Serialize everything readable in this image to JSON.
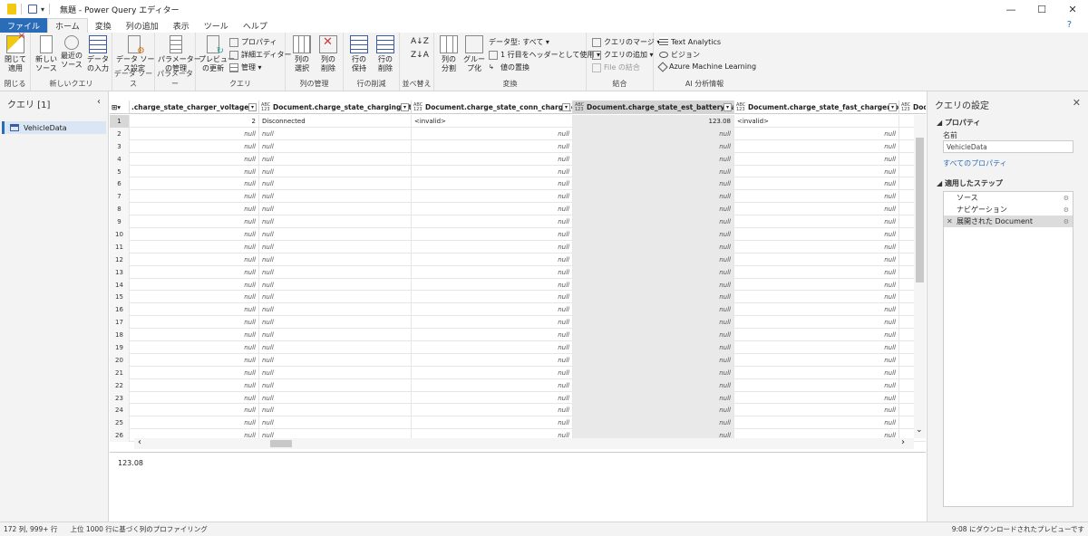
{
  "window": {
    "title": "無題 - Power Query エディター"
  },
  "tabs": [
    "ファイル",
    "ホーム",
    "変換",
    "列の追加",
    "表示",
    "ツール",
    "ヘルプ"
  ],
  "ribbon": {
    "close_apply": "閉じて\n適用",
    "new_source": "新しい\nソース",
    "recent_source": "最近の\nソース",
    "data_input": "データ\nの入力",
    "data_source_settings": "データ ソー\nス設定",
    "manage_params": "パラメーター\nの管理",
    "refresh_preview": "プレビュー\nの更新",
    "properties": "プロパティ",
    "advanced_editor": "詳細エディター",
    "manage": "管理",
    "choose_cols": "列の\n選択",
    "remove_cols": "列の\n削除",
    "keep_rows": "行の\n保持",
    "remove_rows": "行の\n削除",
    "split_col": "列の\n分割",
    "group_by": "グルー\nプ化",
    "data_type": "データ型: すべて",
    "first_row_header": "1 行目をヘッダーとして使用",
    "replace_values": "値の置換",
    "merge_queries": "クエリのマージ",
    "append_queries": "クエリの追加",
    "combine_files": "File の結合",
    "text_analytics": "Text Analytics",
    "vision": "ビジョン",
    "azure_ml": "Azure Machine Learning",
    "groups": [
      "閉じる",
      "新しいクエリ",
      "データ ソース",
      "パラメーター",
      "クエリ",
      "列の管理",
      "行の削減",
      "並べ替え",
      "変換",
      "結合",
      "AI 分析情報"
    ]
  },
  "queries": {
    "header": "クエリ [1]",
    "items": [
      "VehicleData"
    ]
  },
  "grid": {
    "columns": [
      {
        "name": ".charge_state_charger_voltage",
        "type": ""
      },
      {
        "name": "Document.charge_state_charging_state",
        "type": "ABC\n123"
      },
      {
        "name": "Document.charge_state_conn_charge_cable",
        "type": "ABC\n123"
      },
      {
        "name": "Document.charge_state_est_battery_range",
        "type": "ABC\n123"
      },
      {
        "name": "Document.charge_state_fast_charger_brand",
        "type": "ABC\n123"
      },
      {
        "name": "Document",
        "type": "ABC\n123"
      }
    ],
    "first_row": [
      "2",
      "Disconnected",
      "<invalid>",
      "123.08",
      "<invalid>",
      ""
    ],
    "null_text": "null",
    "row_count_shown": 26
  },
  "preview_value": "123.08",
  "settings": {
    "title": "クエリの設定",
    "properties": "プロパティ",
    "name_label": "名前",
    "name_value": "VehicleData",
    "all_props": "すべてのプロパティ",
    "applied_steps": "適用したステップ",
    "steps": [
      "ソース",
      "ナビゲーション",
      "展開された Document"
    ]
  },
  "status": {
    "left": "172 列, 999+ 行",
    "middle": "上位 1000 行に基づく列のプロファイリング",
    "right": "9:08 にダウンロードされたプレビューです"
  }
}
